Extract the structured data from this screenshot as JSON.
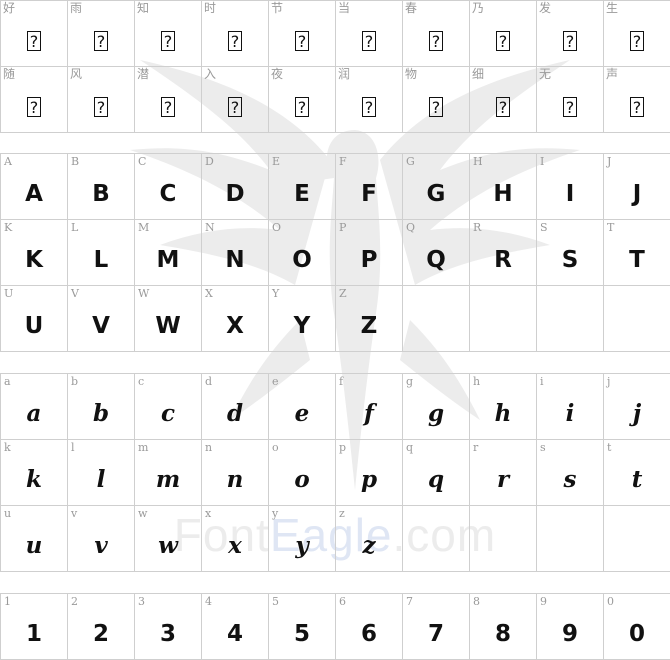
{
  "watermark": {
    "brand_left": "Font",
    "brand_right": "Eagle",
    "brand_suffix": ".com"
  },
  "missing_glyph": "?",
  "sections": [
    {
      "id": "chinese",
      "rows": [
        [
          "好",
          "雨",
          "知",
          "时",
          "节",
          "当",
          "春",
          "乃",
          "发",
          "生"
        ],
        [
          "随",
          "风",
          "潜",
          "入",
          "夜",
          "润",
          "物",
          "细",
          "无",
          "声"
        ]
      ]
    },
    {
      "id": "uppercase",
      "rows": [
        [
          "A",
          "B",
          "C",
          "D",
          "E",
          "F",
          "G",
          "H",
          "I",
          "J"
        ],
        [
          "K",
          "L",
          "M",
          "N",
          "O",
          "P",
          "Q",
          "R",
          "S",
          "T"
        ],
        [
          "U",
          "V",
          "W",
          "X",
          "Y",
          "Z"
        ]
      ]
    },
    {
      "id": "lowercase",
      "rows": [
        [
          "a",
          "b",
          "c",
          "d",
          "e",
          "f",
          "g",
          "h",
          "i",
          "j"
        ],
        [
          "k",
          "l",
          "m",
          "n",
          "o",
          "p",
          "q",
          "r",
          "s",
          "t"
        ],
        [
          "u",
          "v",
          "w",
          "x",
          "y",
          "z"
        ]
      ]
    },
    {
      "id": "digits",
      "rows": [
        [
          "1",
          "2",
          "3",
          "4",
          "5",
          "6",
          "7",
          "8",
          "9",
          "0"
        ]
      ]
    }
  ]
}
